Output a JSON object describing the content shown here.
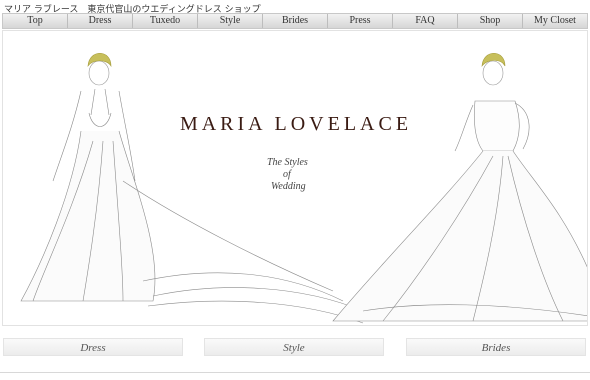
{
  "header": {
    "title_text": "マリア ラブレース　東京代官山のウエディングドレス ショップ"
  },
  "nav": [
    {
      "label": "Top"
    },
    {
      "label": "Dress"
    },
    {
      "label": "Tuxedo"
    },
    {
      "label": "Style"
    },
    {
      "label": "Brides"
    },
    {
      "label": "Press"
    },
    {
      "label": "FAQ"
    },
    {
      "label": "Shop"
    },
    {
      "label": "My Closet"
    }
  ],
  "hero": {
    "brand": "MARIA LOVELACE",
    "tagline_lines": [
      "The Styles",
      "of",
      "Wedding"
    ]
  },
  "cards": [
    {
      "label": "Dress"
    },
    {
      "label": "Style"
    },
    {
      "label": "Brides"
    }
  ]
}
